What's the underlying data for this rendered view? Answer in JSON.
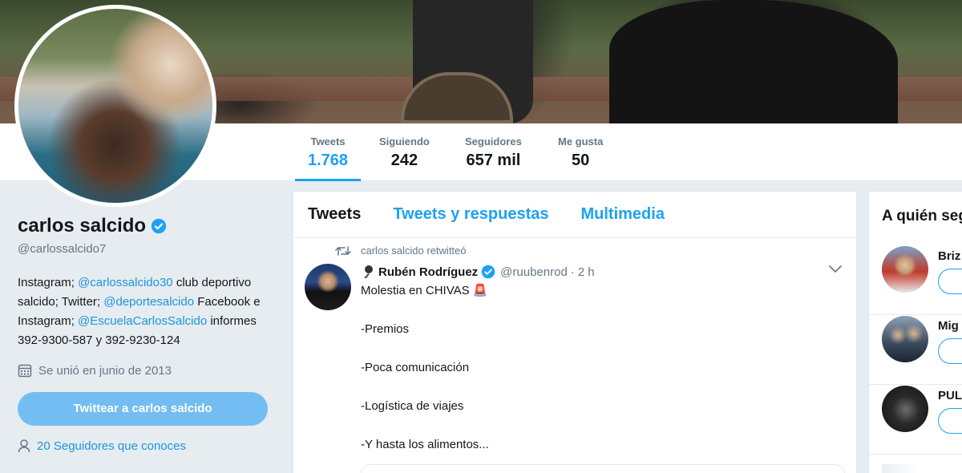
{
  "profile_nav": {
    "stats": [
      {
        "label": "Tweets",
        "value": "1.768"
      },
      {
        "label": "Siguiendo",
        "value": "242"
      },
      {
        "label": "Seguidores",
        "value": "657 mil"
      },
      {
        "label": "Me gusta",
        "value": "50"
      }
    ]
  },
  "profile": {
    "name": "carlos salcido",
    "handle": "@carlossalcido7",
    "bio": {
      "t1": "Instagram; ",
      "l1": "@carlossalcido30",
      "t2": " club deportivo salcido; Twitter; ",
      "l2": "@deportesalcido",
      "t3": " Facebook e Instagram; ",
      "l3": "@EscuelaCarlosSalcido",
      "t4": " informes 392-9300-587 y 392-9230-124"
    },
    "joined": "Se unió en junio de 2013",
    "tweet_to_label": "Twittear a carlos salcido",
    "followers_you_know": "20 Seguidores que conoces"
  },
  "timeline": {
    "tabs": [
      "Tweets",
      "Tweets y respuestas",
      "Multimedia"
    ],
    "retweet_context": "carlos salcido retwitteó",
    "tweet": {
      "author": "Rubén Rodríguez",
      "handle": "@ruubenrod",
      "separator": "·",
      "time": "2 h",
      "lines": [
        "Molestia en CHIVAS 🚨",
        "-Premios",
        "-Poca comunicación",
        "-Logística de viajes",
        "-Y hasta los alimentos..."
      ]
    }
  },
  "who_to_follow": {
    "title": "A quién seguir",
    "items": [
      {
        "name": "Briz",
        "avatar_color": "#c0392b"
      },
      {
        "name": "Mig",
        "avatar_color": "#3a4a5c"
      },
      {
        "name": "PUL",
        "avatar_color": "#1f1f1f"
      }
    ]
  },
  "colors": {
    "accent": "#1da1f2",
    "link": "#1b95e0",
    "button": "#73bdf2"
  }
}
